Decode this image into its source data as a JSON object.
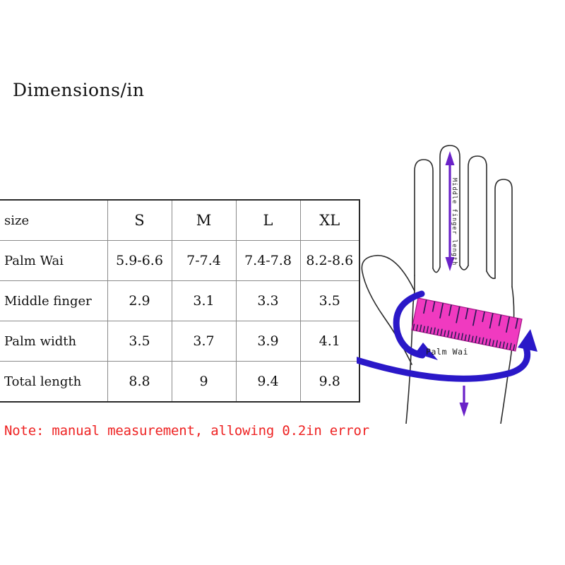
{
  "title": "Dimensions/in",
  "table": {
    "columns": [
      "size",
      "S",
      "M",
      "L",
      "XL"
    ],
    "rows": [
      {
        "label": "Palm Wai",
        "values": [
          "5.9-6.6",
          "7-7.4",
          "7.4-7.8",
          "8.2-8.6"
        ]
      },
      {
        "label": "Middle finger",
        "values": [
          "2.9",
          "3.1",
          "3.3",
          "3.5"
        ]
      },
      {
        "label": "Palm width",
        "values": [
          "3.5",
          "3.7",
          "3.9",
          "4.1"
        ]
      },
      {
        "label": "Total length",
        "values": [
          "8.8",
          "9",
          "9.4",
          "9.8"
        ]
      }
    ]
  },
  "note": "Note: manual measurement, allowing 0.2in error",
  "diagram": {
    "middle_finger_label": "Middle finger length",
    "palm_wai_label": "Palm Wai",
    "colors": {
      "ruler": "#f03ac0",
      "ruler_edge": "#c01a90",
      "arrow_purple": "#6a22c8",
      "arrow_blue": "#2a18c8",
      "hand_outline": "#2b2b2b",
      "note_red": "#ee2222"
    }
  }
}
